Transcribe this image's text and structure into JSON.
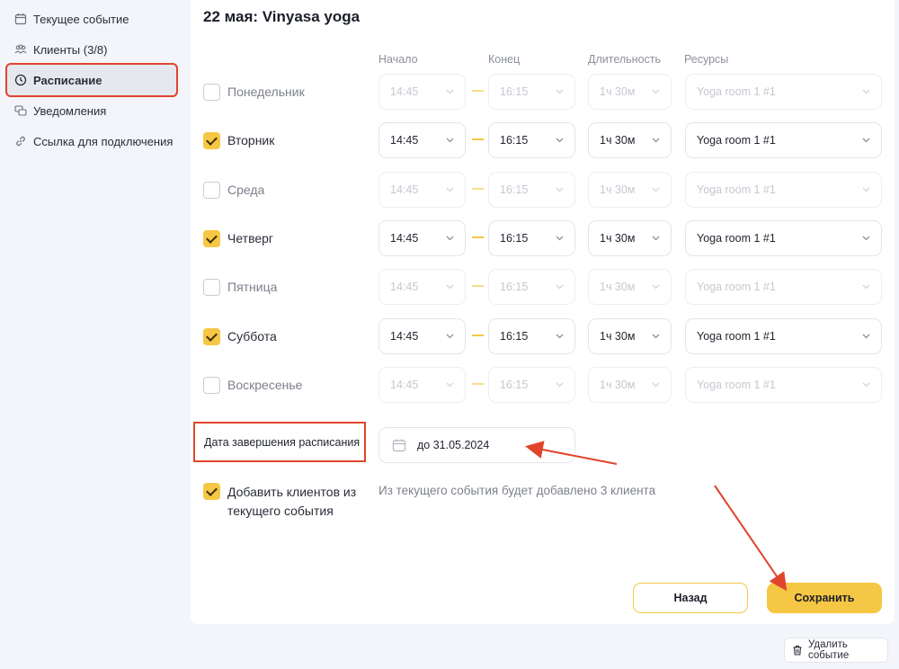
{
  "sidebar": {
    "items": [
      {
        "label": "Текущее событие",
        "icon": "calendar-icon"
      },
      {
        "label": "Клиенты (3/8)",
        "icon": "users-icon"
      },
      {
        "label": "Расписание",
        "icon": "clock-icon",
        "active": true
      },
      {
        "label": "Уведомления",
        "icon": "chat-icon"
      },
      {
        "label": "Ссылка для подключения",
        "icon": "link-icon"
      }
    ]
  },
  "main": {
    "title": "22 мая: Vinyasa yoga",
    "columns": {
      "start": "Начало",
      "end": "Конец",
      "duration": "Длительность",
      "resources": "Ресурсы"
    },
    "days": [
      {
        "name": "Понедельник",
        "checked": false,
        "start": "14:45",
        "end": "16:15",
        "duration": "1ч 30м",
        "resource": "Yoga room 1 #1"
      },
      {
        "name": "Вторник",
        "checked": true,
        "start": "14:45",
        "end": "16:15",
        "duration": "1ч 30м",
        "resource": "Yoga room 1 #1"
      },
      {
        "name": "Среда",
        "checked": false,
        "start": "14:45",
        "end": "16:15",
        "duration": "1ч 30м",
        "resource": "Yoga room 1 #1"
      },
      {
        "name": "Четверг",
        "checked": true,
        "start": "14:45",
        "end": "16:15",
        "duration": "1ч 30м",
        "resource": "Yoga room 1 #1"
      },
      {
        "name": "Пятница",
        "checked": false,
        "start": "14:45",
        "end": "16:15",
        "duration": "1ч 30м",
        "resource": "Yoga room 1 #1"
      },
      {
        "name": "Суббота",
        "checked": true,
        "start": "14:45",
        "end": "16:15",
        "duration": "1ч 30м",
        "resource": "Yoga room 1 #1"
      },
      {
        "name": "Воскресенье",
        "checked": false,
        "start": "14:45",
        "end": "16:15",
        "duration": "1ч 30м",
        "resource": "Yoga room 1 #1"
      }
    ],
    "end_date": {
      "label": "Дата завершения расписания",
      "value": "до 31.05.2024"
    },
    "add_clients": {
      "checked": true,
      "label": "Добавить клиентов из текущего события",
      "note": "Из текущего события будет добавлено 3 клиента"
    },
    "buttons": {
      "back": "Назад",
      "save": "Сохранить"
    }
  },
  "footer": {
    "delete_label": "Удалить событие"
  },
  "colors": {
    "accent": "#f6c744",
    "annotation": "#e0452c"
  }
}
